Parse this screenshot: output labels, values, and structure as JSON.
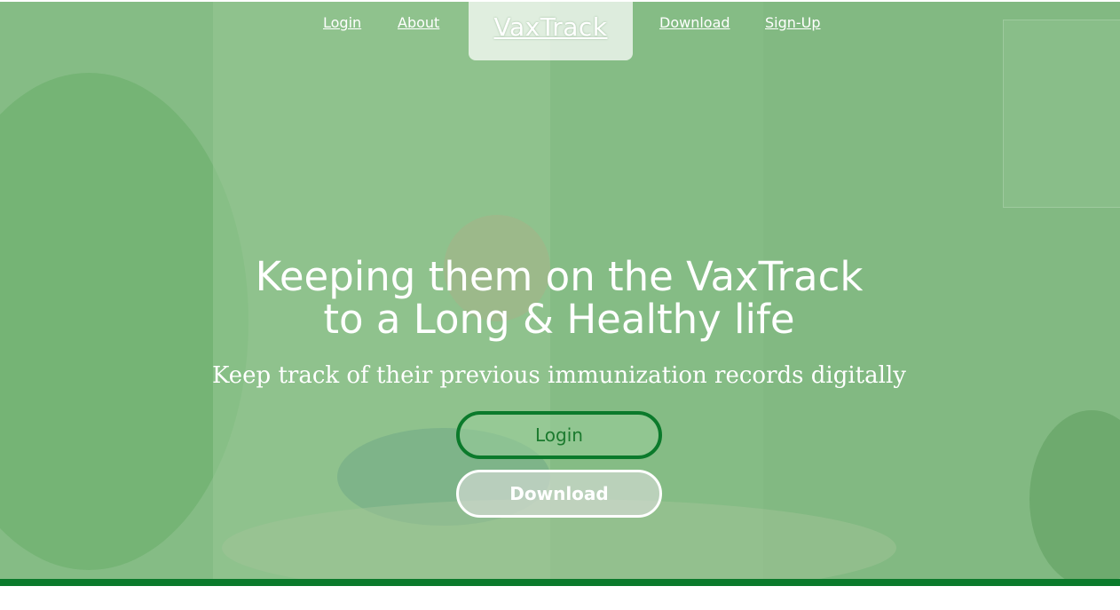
{
  "nav": {
    "login": "Login",
    "about": "About",
    "brand": "VaxTrack",
    "download": "Download",
    "signup": "Sign-Up"
  },
  "hero": {
    "headline_line1": "Keeping them on the VaxTrack",
    "headline_line2": "to a Long & Healthy life",
    "subheading": "Keep track of their previous immunization records digitally",
    "login_button": "Login",
    "download_button": "Download"
  },
  "colors": {
    "accent": "#0b7a2b",
    "overlay": "#8cbd8c",
    "text": "#ffffff"
  }
}
